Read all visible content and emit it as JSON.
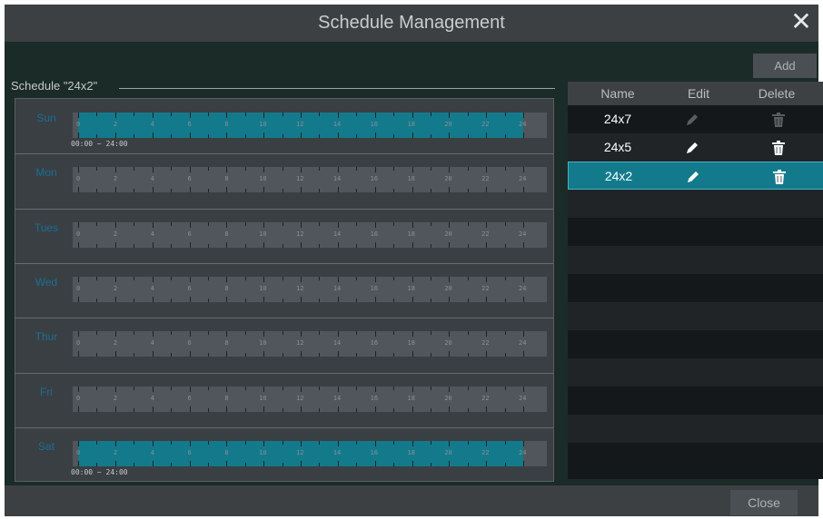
{
  "window": {
    "title": "Schedule Management"
  },
  "schedule": {
    "section_label": "Schedule \"24x2\"",
    "hour_labels": [
      "0",
      "2",
      "4",
      "6",
      "8",
      "10",
      "12",
      "14",
      "16",
      "18",
      "20",
      "22",
      "24"
    ],
    "days": [
      {
        "label": "Sun",
        "active": true,
        "range": "00:00 ~ 24:00"
      },
      {
        "label": "Mon",
        "active": false,
        "range": ""
      },
      {
        "label": "Tues",
        "active": false,
        "range": ""
      },
      {
        "label": "Wed",
        "active": false,
        "range": ""
      },
      {
        "label": "Thur",
        "active": false,
        "range": ""
      },
      {
        "label": "Fri",
        "active": false,
        "range": ""
      },
      {
        "label": "Sat",
        "active": true,
        "range": "00:00 ~ 24:00"
      }
    ]
  },
  "list": {
    "add_label": "Add",
    "headers": {
      "name": "Name",
      "edit": "Edit",
      "delete": "Delete"
    },
    "rows": [
      {
        "name": "24x7",
        "enabled": false,
        "selected": false
      },
      {
        "name": "24x5",
        "enabled": true,
        "selected": false
      },
      {
        "name": "24x2",
        "enabled": true,
        "selected": true
      }
    ],
    "icons": {
      "edit": "pencil-icon",
      "delete": "trash-icon"
    }
  },
  "footer": {
    "close_label": "Close"
  },
  "colors": {
    "accent": "#137a8c",
    "day_label": "#1b6f94",
    "background": "#1b2b27",
    "bar": "#50565b"
  }
}
